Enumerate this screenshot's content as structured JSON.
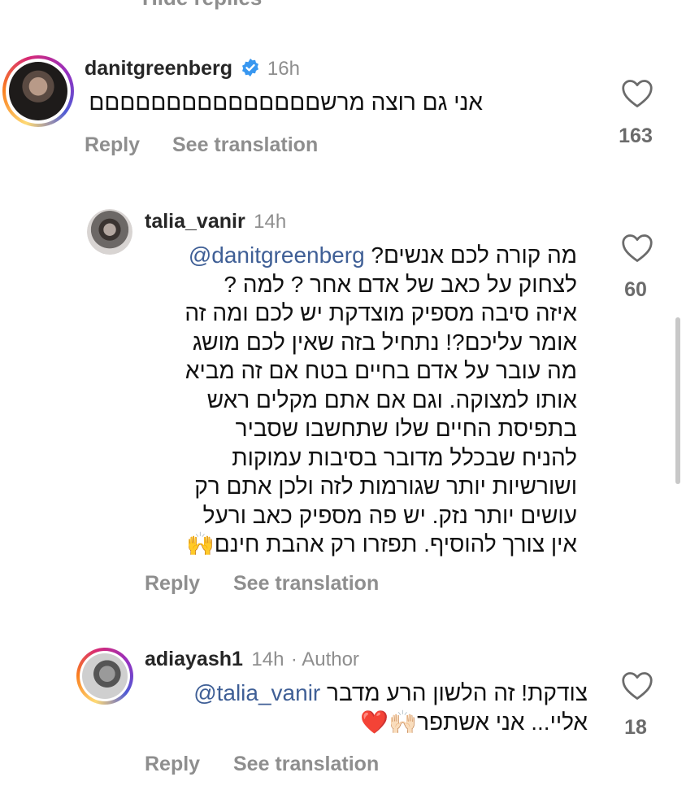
{
  "header": {
    "hide_replies_label": "Hide replies"
  },
  "comments": [
    {
      "username": "danitgreenberg",
      "verified": true,
      "time": "16h",
      "text_lines": [
        "אני גם רוצה מרשםםםםםםםםםםםםםםם"
      ],
      "reply_label": "Reply",
      "translate_label": "See translation",
      "likes": "163"
    },
    {
      "username": "talia_vanir",
      "time": "14h",
      "mention": "@danitgreenberg",
      "text_lines": [
        "מה קורה לכם אנשים?",
        "לצחוק על כאב של אדם אחר ? למה ?",
        "איזה סיבה מספיק מוצדקת יש לכם ומה זה",
        "אומר עליכם?! נתחיל בזה שאין לכם מושג",
        "מה עובר על אדם בחיים בטח אם זה מביא",
        "אותו למצוקה. וגם אם אתם מקלים ראש",
        "בתפיסת החיים שלו שתחשבו שסביר",
        "להניח שבכלל מדובר בסיבות עמוקות",
        "ושורשיות יותר שגורמות לזה ולכן אתם רק",
        "עושים יותר נזק. יש פה מספיק כאב ורעל",
        "אין צורך להוסיף. תפזרו רק אהבת חינם🙌"
      ],
      "reply_label": "Reply",
      "translate_label": "See translation",
      "likes": "60"
    },
    {
      "username": "adiayash1",
      "time": "14h",
      "author_label": "· Author",
      "mention": "@talia_vanir",
      "text_lines": [
        "צודקת! זה הלשון הרע מדבר",
        "אליי... אני אשתפר🙌🏻❤️"
      ],
      "reply_label": "Reply",
      "translate_label": "See translation",
      "likes": "18"
    }
  ],
  "icons": {
    "like": "heart-outline-icon",
    "verified": "verified-badge-icon"
  },
  "colors": {
    "verified": "#3897f0",
    "mention": "#3f5f96",
    "muted": "#8e8e8e"
  }
}
